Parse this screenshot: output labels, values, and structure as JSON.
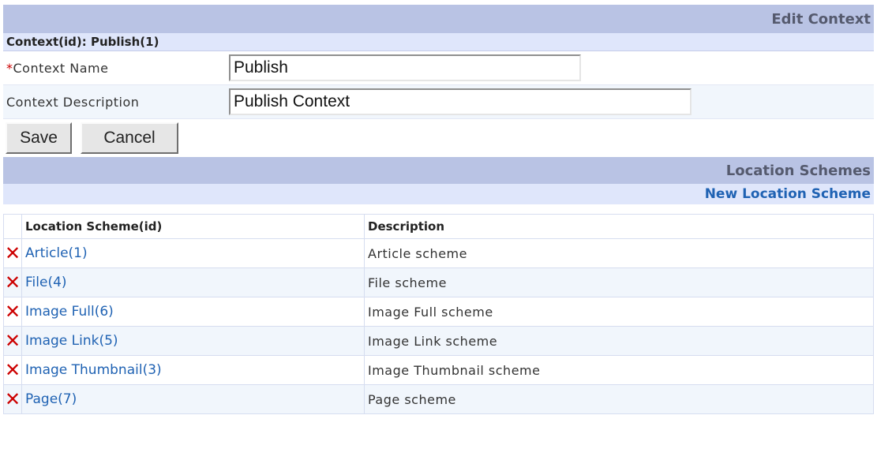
{
  "header": {
    "title": "Edit Context"
  },
  "context": {
    "id_label": "Context(id): Publish(1)",
    "required_mark": "*",
    "name_label": "Context Name",
    "name_value": "Publish",
    "desc_label": "Context Description",
    "desc_value": "Publish Context"
  },
  "buttons": {
    "save": "Save",
    "cancel": "Cancel"
  },
  "schemes": {
    "title": "Location Schemes",
    "new_link": "New Location Scheme",
    "columns": [
      "Location Scheme(id)",
      "Description"
    ],
    "delete_glyph": "✕",
    "rows": [
      {
        "name": "Article(1)",
        "desc": "Article scheme"
      },
      {
        "name": "File(4)",
        "desc": "File scheme"
      },
      {
        "name": "Image Full(6)",
        "desc": "Image Full scheme"
      },
      {
        "name": "Image Link(5)",
        "desc": "Image Link scheme"
      },
      {
        "name": "Image Thumbnail(3)",
        "desc": "Image Thumbnail scheme"
      },
      {
        "name": "Page(7)",
        "desc": "Page scheme"
      }
    ]
  },
  "colors": {
    "header_bg": "#b9c3e4",
    "subheader_bg": "#dfe6fb",
    "link": "#1f62b3",
    "delete": "#cc0000",
    "required": "#cc0000"
  }
}
